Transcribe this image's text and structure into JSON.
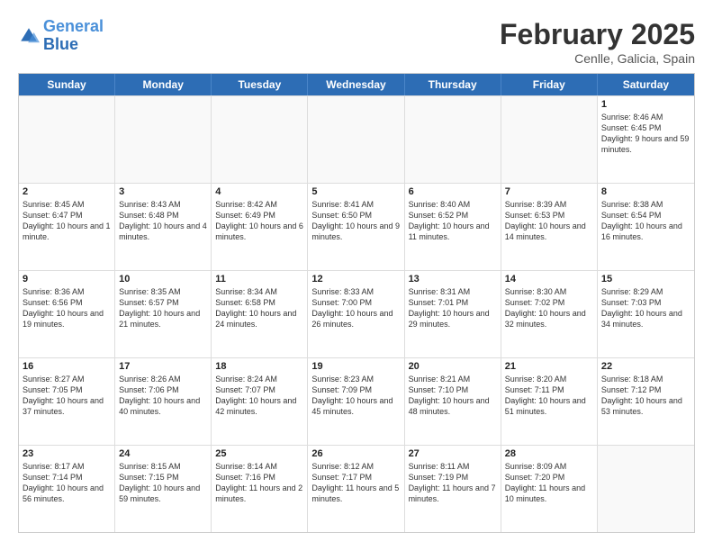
{
  "logo": {
    "line1": "General",
    "line2": "Blue"
  },
  "title": "February 2025",
  "subtitle": "Cenlle, Galicia, Spain",
  "header_days": [
    "Sunday",
    "Monday",
    "Tuesday",
    "Wednesday",
    "Thursday",
    "Friday",
    "Saturday"
  ],
  "weeks": [
    [
      {
        "day": "",
        "info": ""
      },
      {
        "day": "",
        "info": ""
      },
      {
        "day": "",
        "info": ""
      },
      {
        "day": "",
        "info": ""
      },
      {
        "day": "",
        "info": ""
      },
      {
        "day": "",
        "info": ""
      },
      {
        "day": "1",
        "info": "Sunrise: 8:46 AM\nSunset: 6:45 PM\nDaylight: 9 hours and 59 minutes."
      }
    ],
    [
      {
        "day": "2",
        "info": "Sunrise: 8:45 AM\nSunset: 6:47 PM\nDaylight: 10 hours and 1 minute."
      },
      {
        "day": "3",
        "info": "Sunrise: 8:43 AM\nSunset: 6:48 PM\nDaylight: 10 hours and 4 minutes."
      },
      {
        "day": "4",
        "info": "Sunrise: 8:42 AM\nSunset: 6:49 PM\nDaylight: 10 hours and 6 minutes."
      },
      {
        "day": "5",
        "info": "Sunrise: 8:41 AM\nSunset: 6:50 PM\nDaylight: 10 hours and 9 minutes."
      },
      {
        "day": "6",
        "info": "Sunrise: 8:40 AM\nSunset: 6:52 PM\nDaylight: 10 hours and 11 minutes."
      },
      {
        "day": "7",
        "info": "Sunrise: 8:39 AM\nSunset: 6:53 PM\nDaylight: 10 hours and 14 minutes."
      },
      {
        "day": "8",
        "info": "Sunrise: 8:38 AM\nSunset: 6:54 PM\nDaylight: 10 hours and 16 minutes."
      }
    ],
    [
      {
        "day": "9",
        "info": "Sunrise: 8:36 AM\nSunset: 6:56 PM\nDaylight: 10 hours and 19 minutes."
      },
      {
        "day": "10",
        "info": "Sunrise: 8:35 AM\nSunset: 6:57 PM\nDaylight: 10 hours and 21 minutes."
      },
      {
        "day": "11",
        "info": "Sunrise: 8:34 AM\nSunset: 6:58 PM\nDaylight: 10 hours and 24 minutes."
      },
      {
        "day": "12",
        "info": "Sunrise: 8:33 AM\nSunset: 7:00 PM\nDaylight: 10 hours and 26 minutes."
      },
      {
        "day": "13",
        "info": "Sunrise: 8:31 AM\nSunset: 7:01 PM\nDaylight: 10 hours and 29 minutes."
      },
      {
        "day": "14",
        "info": "Sunrise: 8:30 AM\nSunset: 7:02 PM\nDaylight: 10 hours and 32 minutes."
      },
      {
        "day": "15",
        "info": "Sunrise: 8:29 AM\nSunset: 7:03 PM\nDaylight: 10 hours and 34 minutes."
      }
    ],
    [
      {
        "day": "16",
        "info": "Sunrise: 8:27 AM\nSunset: 7:05 PM\nDaylight: 10 hours and 37 minutes."
      },
      {
        "day": "17",
        "info": "Sunrise: 8:26 AM\nSunset: 7:06 PM\nDaylight: 10 hours and 40 minutes."
      },
      {
        "day": "18",
        "info": "Sunrise: 8:24 AM\nSunset: 7:07 PM\nDaylight: 10 hours and 42 minutes."
      },
      {
        "day": "19",
        "info": "Sunrise: 8:23 AM\nSunset: 7:09 PM\nDaylight: 10 hours and 45 minutes."
      },
      {
        "day": "20",
        "info": "Sunrise: 8:21 AM\nSunset: 7:10 PM\nDaylight: 10 hours and 48 minutes."
      },
      {
        "day": "21",
        "info": "Sunrise: 8:20 AM\nSunset: 7:11 PM\nDaylight: 10 hours and 51 minutes."
      },
      {
        "day": "22",
        "info": "Sunrise: 8:18 AM\nSunset: 7:12 PM\nDaylight: 10 hours and 53 minutes."
      }
    ],
    [
      {
        "day": "23",
        "info": "Sunrise: 8:17 AM\nSunset: 7:14 PM\nDaylight: 10 hours and 56 minutes."
      },
      {
        "day": "24",
        "info": "Sunrise: 8:15 AM\nSunset: 7:15 PM\nDaylight: 10 hours and 59 minutes."
      },
      {
        "day": "25",
        "info": "Sunrise: 8:14 AM\nSunset: 7:16 PM\nDaylight: 11 hours and 2 minutes."
      },
      {
        "day": "26",
        "info": "Sunrise: 8:12 AM\nSunset: 7:17 PM\nDaylight: 11 hours and 5 minutes."
      },
      {
        "day": "27",
        "info": "Sunrise: 8:11 AM\nSunset: 7:19 PM\nDaylight: 11 hours and 7 minutes."
      },
      {
        "day": "28",
        "info": "Sunrise: 8:09 AM\nSunset: 7:20 PM\nDaylight: 11 hours and 10 minutes."
      },
      {
        "day": "",
        "info": ""
      }
    ]
  ]
}
